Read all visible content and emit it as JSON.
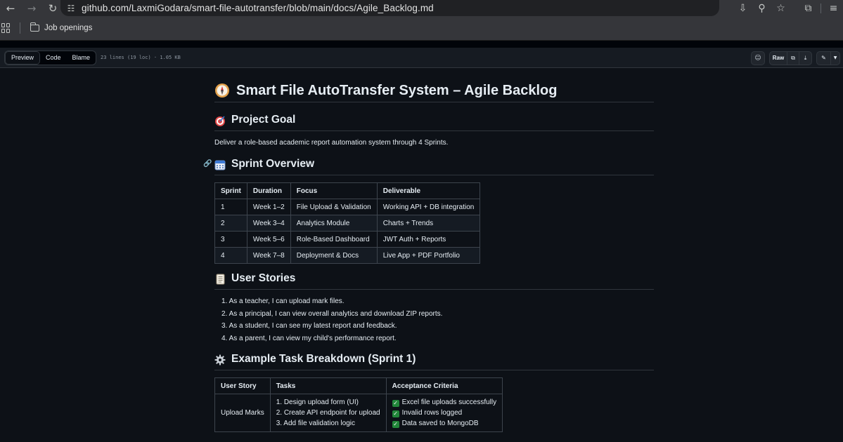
{
  "browser": {
    "url": "github.com/LaxmiGodara/smart-file-autotransfer/blob/main/docs/Agile_Backlog.md",
    "bookmark": "Job openings"
  },
  "file_header": {
    "tabs": [
      "Preview",
      "Code",
      "Blame"
    ],
    "active_tab": "Preview",
    "meta": "23 lines (19 loc) · 1.05 KB",
    "raw_label": "Raw"
  },
  "doc": {
    "title": "Smart File AutoTransfer System – Agile Backlog",
    "goal_heading": "Project Goal",
    "goal_text": "Deliver a role-based academic report automation system through 4 Sprints.",
    "sprint_heading": "Sprint Overview",
    "sprint_table": {
      "headers": [
        "Sprint",
        "Duration",
        "Focus",
        "Deliverable"
      ],
      "rows": [
        [
          "1",
          "Week 1–2",
          "File Upload & Validation",
          "Working API + DB integration"
        ],
        [
          "2",
          "Week 3–4",
          "Analytics Module",
          "Charts + Trends"
        ],
        [
          "3",
          "Week 5–6",
          "Role-Based Dashboard",
          "JWT Auth + Reports"
        ],
        [
          "4",
          "Week 7–8",
          "Deployment & Docs",
          "Live App + PDF Portfolio"
        ]
      ]
    },
    "stories_heading": "User Stories",
    "stories": [
      "1. As a teacher, I can upload mark files.",
      "2. As a principal, I can view overall analytics and download ZIP reports.",
      "3. As a student, I can see my latest report and feedback.",
      "4. As a parent, I can view my child's performance report."
    ],
    "tasks_heading": "Example Task Breakdown (Sprint 1)",
    "tasks_table": {
      "headers": [
        "User Story",
        "Tasks",
        "Acceptance Criteria"
      ],
      "story": "Upload Marks",
      "tasks": [
        "1. Design upload form (UI)",
        "2. Create API endpoint for upload",
        "3. Add file validation logic"
      ],
      "criteria": [
        "Excel file uploads successfully",
        "Invalid rows logged",
        "Data saved to MongoDB"
      ]
    }
  },
  "colors": {
    "background": "#0d1117",
    "border": "#30363d",
    "text": "#e6edf3",
    "check": "#22863a"
  },
  "icons": [
    "back-arrow-icon",
    "forward-arrow-icon",
    "reload-icon",
    "site-settings-icon",
    "install-icon",
    "zoom-icon",
    "star-icon",
    "extensions-icon",
    "reading-list-icon",
    "apps-icon",
    "folder-icon",
    "copilot-icon",
    "copy-icon",
    "download-icon",
    "edit-icon",
    "chevron-down-icon",
    "compass-emoji-icon",
    "target-emoji-icon",
    "calendar-emoji-icon",
    "scroll-emoji-icon",
    "gear-emoji-icon",
    "link-icon",
    "checkmark-icon"
  ]
}
